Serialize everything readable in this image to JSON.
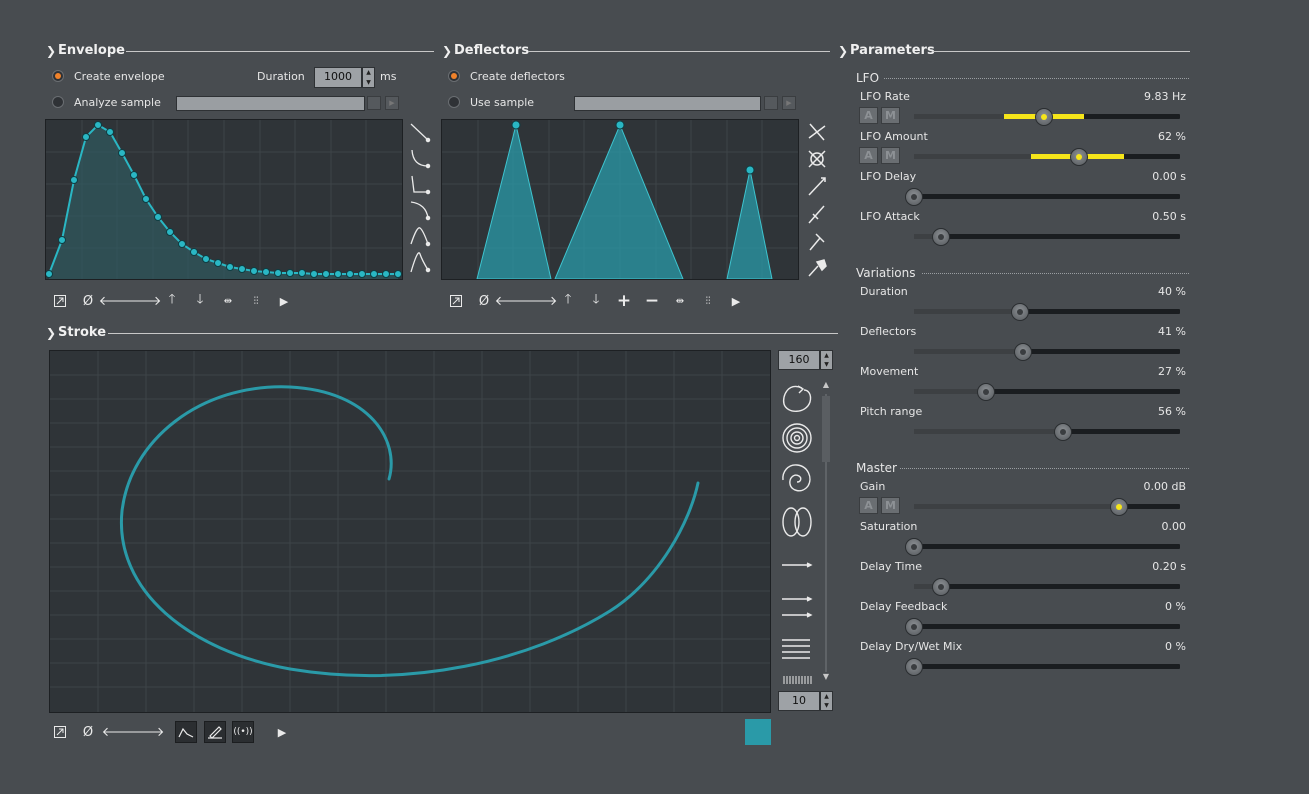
{
  "envelope": {
    "title": "Envelope",
    "create_label": "Create envelope",
    "analyze_label": "Analyze sample",
    "duration_label": "Duration",
    "duration_value": "1000",
    "duration_unit": "ms",
    "create_selected": true
  },
  "deflectors": {
    "title": "Deflectors",
    "create_label": "Create deflectors",
    "use_label": "Use sample",
    "create_selected": true
  },
  "stroke": {
    "title": "Stroke",
    "top_value": "160",
    "bottom_value": "10",
    "color": "#2a9aa8"
  },
  "parameters": {
    "title": "Parameters",
    "lfo": {
      "title": "LFO",
      "items": [
        {
          "name": "LFO Rate",
          "value": "9.83 Hz",
          "level": 0.49,
          "mod_from": 0.34,
          "mod_to": 0.64,
          "am": true
        },
        {
          "name": "LFO Amount",
          "value": "62 %",
          "level": 0.62,
          "mod_from": 0.44,
          "mod_to": 0.79,
          "am": true
        },
        {
          "name": "LFO Delay",
          "value": "0.00 s",
          "level": 0.0,
          "am": false
        },
        {
          "name": "LFO Attack",
          "value": "0.50 s",
          "level": 0.1,
          "am": false
        }
      ]
    },
    "variations": {
      "title": "Variations",
      "items": [
        {
          "name": "Duration",
          "value": "40 %",
          "level": 0.4
        },
        {
          "name": "Deflectors",
          "value": "41 %",
          "level": 0.41
        },
        {
          "name": "Movement",
          "value": "27 %",
          "level": 0.27
        },
        {
          "name": "Pitch range",
          "value": "56 %",
          "level": 0.56
        }
      ]
    },
    "master": {
      "title": "Master",
      "items": [
        {
          "name": "Gain",
          "value": "0.00 dB",
          "level": 0.77,
          "am": true,
          "yellow": true
        },
        {
          "name": "Saturation",
          "value": "0.00",
          "level": 0.0
        },
        {
          "name": "Delay Time",
          "value": "0.20 s",
          "level": 0.1
        },
        {
          "name": "Delay Feedback",
          "value": "0 %",
          "level": 0.0
        },
        {
          "name": "Delay Dry/Wet Mix",
          "value": "0 %",
          "level": 0.0
        }
      ]
    },
    "am_labels": [
      "A",
      "M"
    ]
  },
  "colors": {
    "accent": "#2ab7c4",
    "modulation": "#f6e51a",
    "radio_on": "#f0822a"
  }
}
